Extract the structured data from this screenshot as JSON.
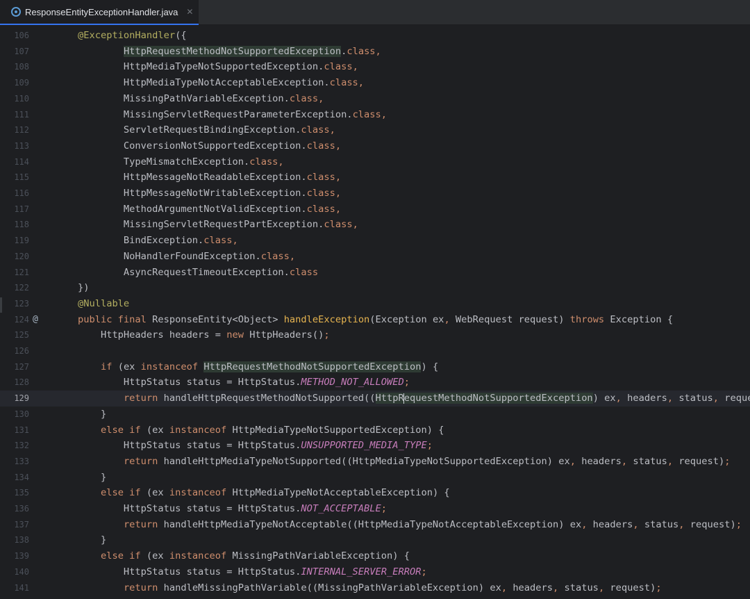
{
  "tab": {
    "icon": "java-class-icon",
    "label": "ResponseEntityExceptionHandler.java",
    "close_icon": "close-icon",
    "close_glyph": "✕"
  },
  "editor": {
    "gutter_icon_glyph": "@",
    "lines": [
      {
        "num": "106",
        "tokens": [
          {
            "t": "@ExceptionHandler",
            "c": "ann"
          },
          {
            "t": "({",
            "c": "plain"
          }
        ]
      },
      {
        "num": "107",
        "tokens": [
          {
            "t": "        "
          },
          {
            "t": "HttpRequestMethodNotSupportedException",
            "c": "hl"
          },
          {
            "t": ".",
            "c": "plain"
          },
          {
            "t": "class",
            "c": "kw"
          },
          {
            "t": ",",
            "c": "kw"
          }
        ]
      },
      {
        "num": "108",
        "tokens": [
          {
            "t": "        HttpMediaTypeNotSupportedException."
          },
          {
            "t": "class",
            "c": "kw"
          },
          {
            "t": ",",
            "c": "kw"
          }
        ]
      },
      {
        "num": "109",
        "tokens": [
          {
            "t": "        HttpMediaTypeNotAcceptableException."
          },
          {
            "t": "class",
            "c": "kw"
          },
          {
            "t": ",",
            "c": "kw"
          }
        ]
      },
      {
        "num": "110",
        "tokens": [
          {
            "t": "        MissingPathVariableException."
          },
          {
            "t": "class",
            "c": "kw"
          },
          {
            "t": ",",
            "c": "kw"
          }
        ]
      },
      {
        "num": "111",
        "tokens": [
          {
            "t": "        MissingServletRequestParameterException."
          },
          {
            "t": "class",
            "c": "kw"
          },
          {
            "t": ",",
            "c": "kw"
          }
        ]
      },
      {
        "num": "112",
        "tokens": [
          {
            "t": "        ServletRequestBindingException."
          },
          {
            "t": "class",
            "c": "kw"
          },
          {
            "t": ",",
            "c": "kw"
          }
        ]
      },
      {
        "num": "113",
        "tokens": [
          {
            "t": "        ConversionNotSupportedException."
          },
          {
            "t": "class",
            "c": "kw"
          },
          {
            "t": ",",
            "c": "kw"
          }
        ]
      },
      {
        "num": "114",
        "tokens": [
          {
            "t": "        TypeMismatchException."
          },
          {
            "t": "class",
            "c": "kw"
          },
          {
            "t": ",",
            "c": "kw"
          }
        ]
      },
      {
        "num": "115",
        "tokens": [
          {
            "t": "        HttpMessageNotReadableException."
          },
          {
            "t": "class",
            "c": "kw"
          },
          {
            "t": ",",
            "c": "kw"
          }
        ]
      },
      {
        "num": "116",
        "tokens": [
          {
            "t": "        HttpMessageNotWritableException."
          },
          {
            "t": "class",
            "c": "kw"
          },
          {
            "t": ",",
            "c": "kw"
          }
        ]
      },
      {
        "num": "117",
        "tokens": [
          {
            "t": "        MethodArgumentNotValidException."
          },
          {
            "t": "class",
            "c": "kw"
          },
          {
            "t": ",",
            "c": "kw"
          }
        ]
      },
      {
        "num": "118",
        "tokens": [
          {
            "t": "        MissingServletRequestPartException."
          },
          {
            "t": "class",
            "c": "kw"
          },
          {
            "t": ",",
            "c": "kw"
          }
        ]
      },
      {
        "num": "119",
        "tokens": [
          {
            "t": "        BindException."
          },
          {
            "t": "class",
            "c": "kw"
          },
          {
            "t": ",",
            "c": "kw"
          }
        ]
      },
      {
        "num": "120",
        "tokens": [
          {
            "t": "        NoHandlerFoundException."
          },
          {
            "t": "class",
            "c": "kw"
          },
          {
            "t": ",",
            "c": "kw"
          }
        ]
      },
      {
        "num": "121",
        "tokens": [
          {
            "t": "        AsyncRequestTimeoutException."
          },
          {
            "t": "class",
            "c": "kw"
          }
        ]
      },
      {
        "num": "122",
        "tokens": [
          {
            "t": "})"
          }
        ]
      },
      {
        "num": "123",
        "tokens": [
          {
            "t": "@Nullable",
            "c": "ann"
          }
        ]
      },
      {
        "num": "124",
        "icon": true,
        "tokens": [
          {
            "t": "public final ",
            "c": "kw"
          },
          {
            "t": "ResponseEntity<Object> "
          },
          {
            "t": "handleException",
            "c": "fnd"
          },
          {
            "t": "(Exception ex"
          },
          {
            "t": ", ",
            "c": "kw"
          },
          {
            "t": "WebRequest request) "
          },
          {
            "t": "throws ",
            "c": "kw"
          },
          {
            "t": "Exception {"
          }
        ]
      },
      {
        "num": "125",
        "tokens": [
          {
            "t": "    HttpHeaders headers = "
          },
          {
            "t": "new ",
            "c": "kw"
          },
          {
            "t": "HttpHeaders()"
          },
          {
            "t": ";",
            "c": "kw"
          }
        ]
      },
      {
        "num": "126",
        "tokens": []
      },
      {
        "num": "127",
        "tokens": [
          {
            "t": "    "
          },
          {
            "t": "if ",
            "c": "kw"
          },
          {
            "t": "(ex "
          },
          {
            "t": "instanceof ",
            "c": "kw"
          },
          {
            "t": "HttpRequestMethodNotSupportedException",
            "c": "hl"
          },
          {
            "t": ") {"
          }
        ]
      },
      {
        "num": "128",
        "tokens": [
          {
            "t": "        HttpStatus status = HttpStatus."
          },
          {
            "t": "METHOD_NOT_ALLOWED",
            "c": "const"
          },
          {
            "t": ";",
            "c": "kw"
          }
        ]
      },
      {
        "num": "129",
        "current": true,
        "tokens": [
          {
            "t": "        "
          },
          {
            "t": "return ",
            "c": "kw"
          },
          {
            "t": "handleHttpRequestMethodNotSupported(("
          },
          {
            "t": "HttpR",
            "c": "hl"
          },
          {
            "caret": true
          },
          {
            "t": "equestMethodNotSupportedException",
            "c": "hl"
          },
          {
            "t": ") ex"
          },
          {
            "t": ", ",
            "c": "kw"
          },
          {
            "t": "headers"
          },
          {
            "t": ", ",
            "c": "kw"
          },
          {
            "t": "status"
          },
          {
            "t": ", ",
            "c": "kw"
          },
          {
            "t": "request)"
          },
          {
            "t": ";",
            "c": "kw"
          }
        ]
      },
      {
        "num": "130",
        "tokens": [
          {
            "t": "    }"
          }
        ]
      },
      {
        "num": "131",
        "tokens": [
          {
            "t": "    "
          },
          {
            "t": "else if ",
            "c": "kw"
          },
          {
            "t": "(ex "
          },
          {
            "t": "instanceof ",
            "c": "kw"
          },
          {
            "t": "HttpMediaTypeNotSupportedException) {"
          }
        ]
      },
      {
        "num": "132",
        "tokens": [
          {
            "t": "        HttpStatus status = HttpStatus."
          },
          {
            "t": "UNSUPPORTED_MEDIA_TYPE",
            "c": "const"
          },
          {
            "t": ";",
            "c": "kw"
          }
        ]
      },
      {
        "num": "133",
        "tokens": [
          {
            "t": "        "
          },
          {
            "t": "return ",
            "c": "kw"
          },
          {
            "t": "handleHttpMediaTypeNotSupported((HttpMediaTypeNotSupportedException) ex"
          },
          {
            "t": ", ",
            "c": "kw"
          },
          {
            "t": "headers"
          },
          {
            "t": ", ",
            "c": "kw"
          },
          {
            "t": "status"
          },
          {
            "t": ", ",
            "c": "kw"
          },
          {
            "t": "request)"
          },
          {
            "t": ";",
            "c": "kw"
          }
        ]
      },
      {
        "num": "134",
        "tokens": [
          {
            "t": "    }"
          }
        ]
      },
      {
        "num": "135",
        "tokens": [
          {
            "t": "    "
          },
          {
            "t": "else if ",
            "c": "kw"
          },
          {
            "t": "(ex "
          },
          {
            "t": "instanceof ",
            "c": "kw"
          },
          {
            "t": "HttpMediaTypeNotAcceptableException) {"
          }
        ]
      },
      {
        "num": "136",
        "tokens": [
          {
            "t": "        HttpStatus status = HttpStatus."
          },
          {
            "t": "NOT_ACCEPTABLE",
            "c": "const"
          },
          {
            "t": ";",
            "c": "kw"
          }
        ]
      },
      {
        "num": "137",
        "tokens": [
          {
            "t": "        "
          },
          {
            "t": "return ",
            "c": "kw"
          },
          {
            "t": "handleHttpMediaTypeNotAcceptable((HttpMediaTypeNotAcceptableException) ex"
          },
          {
            "t": ", ",
            "c": "kw"
          },
          {
            "t": "headers"
          },
          {
            "t": ", ",
            "c": "kw"
          },
          {
            "t": "status"
          },
          {
            "t": ", ",
            "c": "kw"
          },
          {
            "t": "request)"
          },
          {
            "t": ";",
            "c": "kw"
          }
        ]
      },
      {
        "num": "138",
        "tokens": [
          {
            "t": "    }"
          }
        ]
      },
      {
        "num": "139",
        "tokens": [
          {
            "t": "    "
          },
          {
            "t": "else if ",
            "c": "kw"
          },
          {
            "t": "(ex "
          },
          {
            "t": "instanceof ",
            "c": "kw"
          },
          {
            "t": "MissingPathVariableException) {"
          }
        ]
      },
      {
        "num": "140",
        "tokens": [
          {
            "t": "        HttpStatus status = HttpStatus."
          },
          {
            "t": "INTERNAL_SERVER_ERROR",
            "c": "const"
          },
          {
            "t": ";",
            "c": "kw"
          }
        ]
      },
      {
        "num": "141",
        "tokens": [
          {
            "t": "        "
          },
          {
            "t": "return ",
            "c": "kw"
          },
          {
            "t": "handleMissingPathVariable((MissingPathVariableException) ex"
          },
          {
            "t": ", ",
            "c": "kw"
          },
          {
            "t": "headers"
          },
          {
            "t": ", ",
            "c": "kw"
          },
          {
            "t": "status"
          },
          {
            "t": ", ",
            "c": "kw"
          },
          {
            "t": "request)"
          },
          {
            "t": ";",
            "c": "kw"
          }
        ]
      }
    ]
  }
}
